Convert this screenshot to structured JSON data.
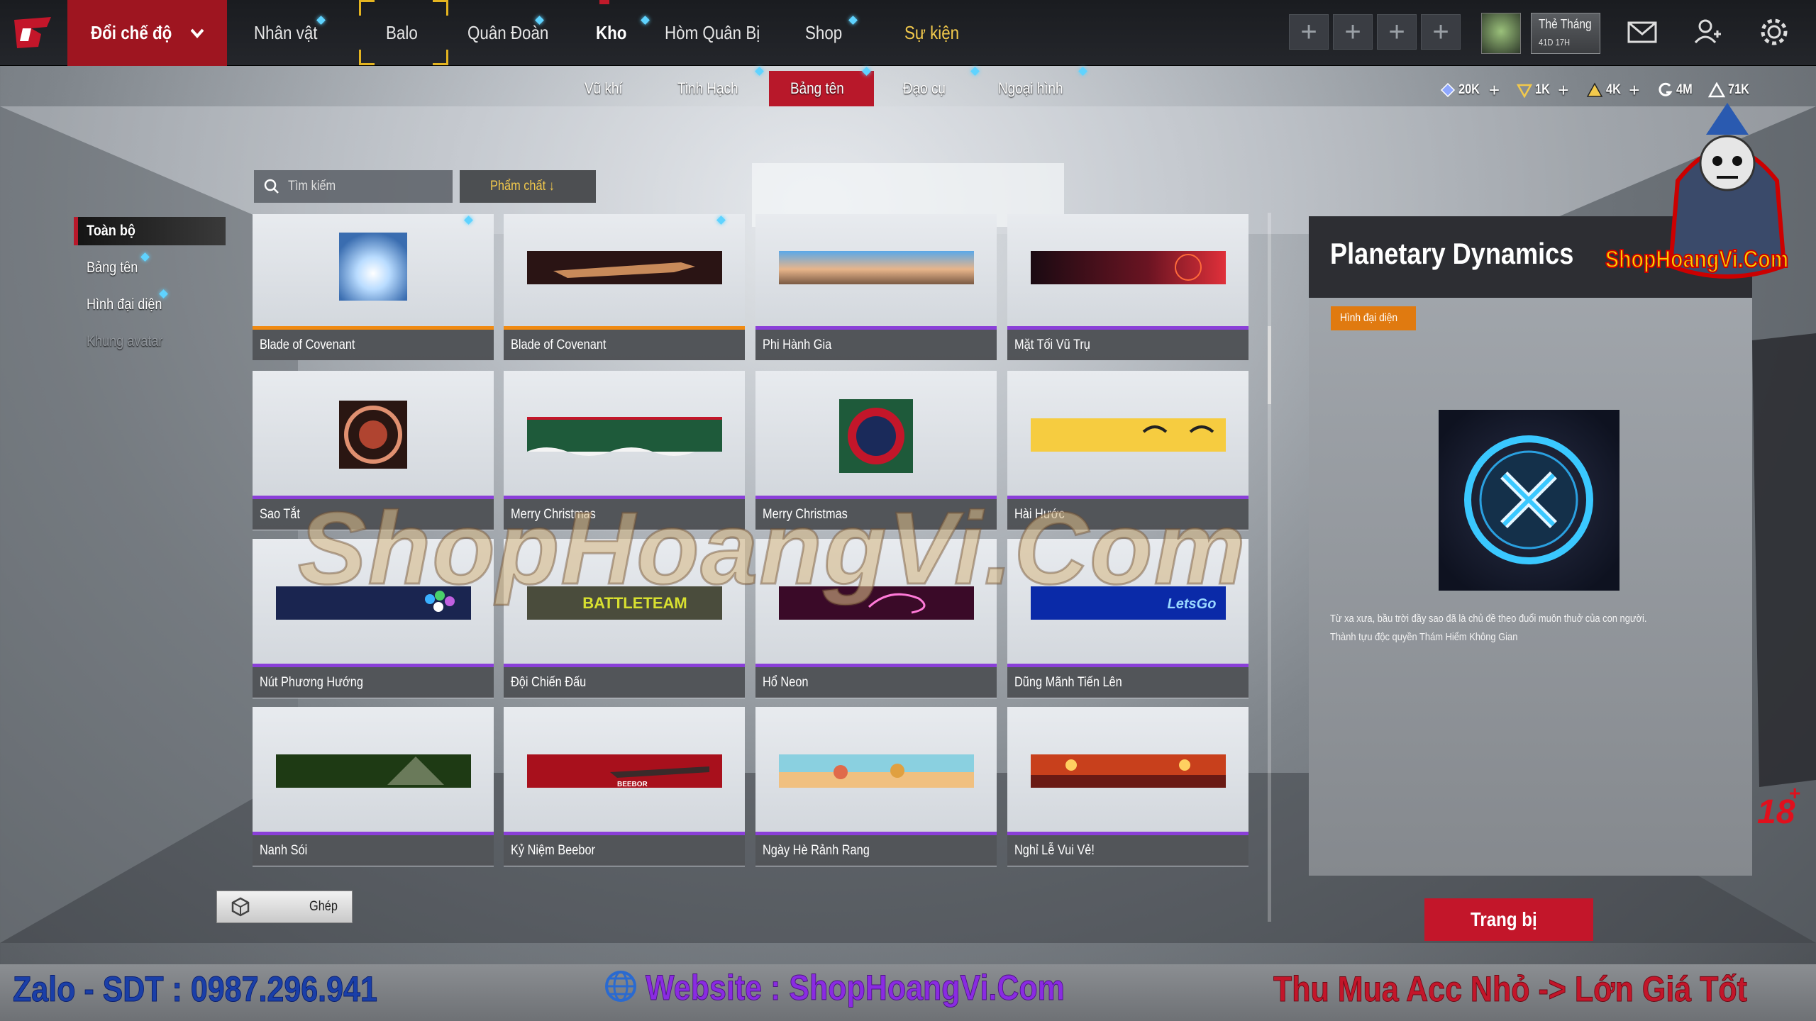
{
  "topbar": {
    "mode_label": "Đổi chế độ",
    "nav": [
      "Nhân vật",
      "Balo",
      "Quân Đoàn",
      "Kho",
      "Hòm Quân Bị",
      "Shop",
      "Sự kiện"
    ],
    "active_nav": "Kho",
    "monthly_card": {
      "title": "Thẻ Tháng",
      "time_left": "41D 17H"
    }
  },
  "subtabs": {
    "items": [
      "Vũ khí",
      "Tinh Hạch",
      "Bảng tên",
      "Đạo cụ",
      "Ngoại hình"
    ],
    "active": "Bảng tên"
  },
  "currencies": [
    {
      "icon": "diamond-icon",
      "value": "20K",
      "plus": true
    },
    {
      "icon": "coupon-icon",
      "value": "1K",
      "plus": true
    },
    {
      "icon": "gold-triangle-icon",
      "value": "4K",
      "plus": true
    },
    {
      "icon": "g-coin-icon",
      "value": "4M",
      "plus": false
    },
    {
      "icon": "points-triangle-icon",
      "value": "71K",
      "plus": false
    }
  ],
  "search": {
    "placeholder": "Tìm kiếm",
    "sort_label": "Phẩm chất ↓"
  },
  "filters": {
    "items": [
      "Toàn bộ",
      "Bảng tên",
      "Hình đại diện",
      "Khung avatar"
    ],
    "active": "Toàn bộ",
    "disabled": "Khung avatar"
  },
  "items": [
    {
      "name": "Blade of Covenant",
      "rarity": "orange"
    },
    {
      "name": "Blade of Covenant",
      "rarity": "orange"
    },
    {
      "name": "Phi Hành Gia",
      "rarity": "purple"
    },
    {
      "name": "Mặt Tối Vũ Trụ",
      "rarity": "purple"
    },
    {
      "name": "Sao Tắt",
      "rarity": "purple"
    },
    {
      "name": "Merry Christmas",
      "rarity": "purple"
    },
    {
      "name": "Merry Christmas",
      "rarity": "purple"
    },
    {
      "name": "Hài Hước",
      "rarity": "purple"
    },
    {
      "name": "Nút Phương Hướng",
      "rarity": "purple"
    },
    {
      "name": "Đội Chiến Đấu",
      "rarity": "purple"
    },
    {
      "name": "Hổ Neon",
      "rarity": "purple"
    },
    {
      "name": "Dũng Mãnh Tiến Lên",
      "rarity": "purple"
    },
    {
      "name": "Nanh Sói",
      "rarity": "purple"
    },
    {
      "name": "Kỷ Niệm Beebor",
      "rarity": "purple"
    },
    {
      "name": "Ngày Hè Rảnh Rang",
      "rarity": "purple"
    },
    {
      "name": "Nghỉ Lễ Vui Vẻ!",
      "rarity": "purple"
    }
  ],
  "banner_texts": {
    "battle": "BATTLETEAM",
    "letsgo": "LetsGo",
    "beebor": "BEEBOR"
  },
  "detail": {
    "title": "Planetary Dynamics",
    "category": "Hình đại diện",
    "description_lines": [
      "Từ xa xưa, bầu trời đầy sao đã là chủ đề theo đuổi muôn thuở của con người.",
      "Thành tựu độc quyền Thám Hiểm Không Gian"
    ]
  },
  "buttons": {
    "merge": "Ghép",
    "equip": "Trang bị"
  },
  "age_rating": "18",
  "age_rating_plus": "+",
  "overlay": {
    "watermark": "ShopHoangVi.Com",
    "shop_logo_text": "ShopHoangVi.Com",
    "promo_left": "Zalo - SDT : 0987.296.941",
    "promo_center": "Website : ShopHoangVi.Com",
    "promo_right": "Thu Mua Acc Nhỏ -> Lớn Giá Tốt"
  },
  "colors": {
    "accent_red": "#b8182a",
    "rarity_orange": "#f08a12",
    "rarity_purple": "#8a3fd8",
    "event_yellow": "#f2c94c",
    "notify_dot": "#5fd3ff"
  }
}
